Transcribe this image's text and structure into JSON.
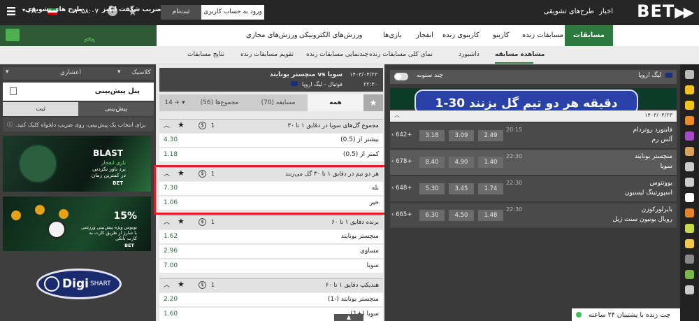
{
  "topbar": {
    "logo": "BET",
    "links": [
      "اخبار",
      "طرح‌های تشویقی"
    ],
    "login_label": "ورود به حساب کاربری",
    "signup_label": "ثبت‌نام",
    "clock": "۱۲:۵۸:۰۷",
    "language": "FA"
  },
  "promo": {
    "item1": "ضریب شگفت انگیز",
    "item2": "طرح های تشویقی"
  },
  "nav": {
    "active": "مسابقات ورزشی",
    "items": [
      "مسابقات زنده",
      "کازینو",
      "کازینوی زنده",
      "انفجار",
      "بازی‌ها",
      "ورزش‌های الکترونیکی",
      "ورزش‌های مجازی"
    ]
  },
  "subnav": {
    "items": [
      "مشاهده مسابقه",
      "داشبورد",
      "نمای کلی مسابقات زنده",
      "چندنمایی مسابقات زنده",
      "تقویم مسابقات زنده",
      "نتایج مسابقات"
    ]
  },
  "left": {
    "classic": "کلاسیک",
    "decimal": "اعشاری",
    "betslip_title": "پنل پیش‌بینی",
    "tab_betslip": "پیش‌بینی",
    "tab_register": "ثبت",
    "hint": "برای انتخاب یک پیش‌بینی، روی ضریب دلخواه کلیک کنید.",
    "banner1_title": "BLAST",
    "banner1_line1": "بازی انفجار",
    "banner1_line2": "برد باور نکردنی",
    "banner1_line3": "در کمترین زمان",
    "banner_brand": "BET",
    "banner2_pct": "15%",
    "banner2_line1": "بونوس ویژه پیش‌بینی ورزشی",
    "banner2_line2": "با شارژ از طریق کارت به",
    "banner2_line3": "کارت بانکی",
    "digi_text": "Digi",
    "digi_sub": "SHART"
  },
  "match": {
    "teams": "منچستر یونایتد vs سویا",
    "date": "۱۴۰۳/۰۴/۲۳",
    "time": "۲۲:۳۰",
    "league": "فوتبال - لیگ اروپا"
  },
  "mid_tabs": {
    "all": "همه",
    "match": "مسابقه (70)",
    "totals": "مجموع‌ها (56)",
    "more": "14 +"
  },
  "markets": [
    {
      "title": "مجموع گل‌های سویا در دقایق ۱ تا ۳۰",
      "num": "1",
      "rows": [
        {
          "label": "بیشتر از (0.5)",
          "odd": "4.30"
        },
        {
          "label": "کمتر از (0.5)",
          "odd": "1.18"
        }
      ]
    },
    {
      "title": "هر دو تیم در دقایق ۱ تا ۳۰ گل می‌زنند",
      "num": "1",
      "rows": [
        {
          "label": "بله",
          "odd": "7.30"
        },
        {
          "label": "خیر",
          "odd": "1.06"
        }
      ]
    },
    {
      "title": "برنده دقایق ۱ تا ۶۰",
      "num": "1",
      "rows": [
        {
          "label": "منچستر یونایتد",
          "odd": "1.62"
        },
        {
          "label": "مساوی",
          "odd": "2.96"
        },
        {
          "label": "سویا",
          "odd": "7.00"
        }
      ]
    },
    {
      "title": "هندیکپ دقایق ۱ تا ۶۰",
      "num": "1",
      "rows": [
        {
          "label": "منچستر یونایتد (-1)",
          "odd": "2.20"
        },
        {
          "label": "سویا (+1)",
          "odd": "1.60"
        }
      ]
    }
  ],
  "right": {
    "league": "لیگ اروپا",
    "multi_column": "چند ستونه",
    "headline": "دقیقه هر دو تیم گل بزنند 30-1",
    "date": "۱۴۰۳/۰۴/۲۳",
    "events": [
      {
        "home": "فاینورد روتردام",
        "away": "آلس رم",
        "time": "20:15",
        "odds": [
          "2.49",
          "3.09",
          "3.18"
        ],
        "more": "642+"
      },
      {
        "home": "منچستر یونایتد",
        "away": "سویا",
        "time": "22:30",
        "odds": [
          "1.40",
          "4.90",
          "8.40"
        ],
        "more": "678+"
      },
      {
        "home": "یوونتوس",
        "away": "اسپورتینگ لیسبون",
        "time": "22:30",
        "odds": [
          "1.74",
          "3.45",
          "5.30"
        ],
        "more": "648+"
      },
      {
        "home": "بایرلورکوزن",
        "away": "رویال یونیون سنت ژیل",
        "time": "22:30",
        "odds": [
          "1.48",
          "4.50",
          "6.30"
        ],
        "more": "665+"
      }
    ],
    "support": "چت زنده با پشتیبان ۲۴ ساعته"
  },
  "colors": {
    "brand_green": "#2d7a3f",
    "highlight_red": "#e21c24",
    "headline_blue": "#2a42a8"
  }
}
